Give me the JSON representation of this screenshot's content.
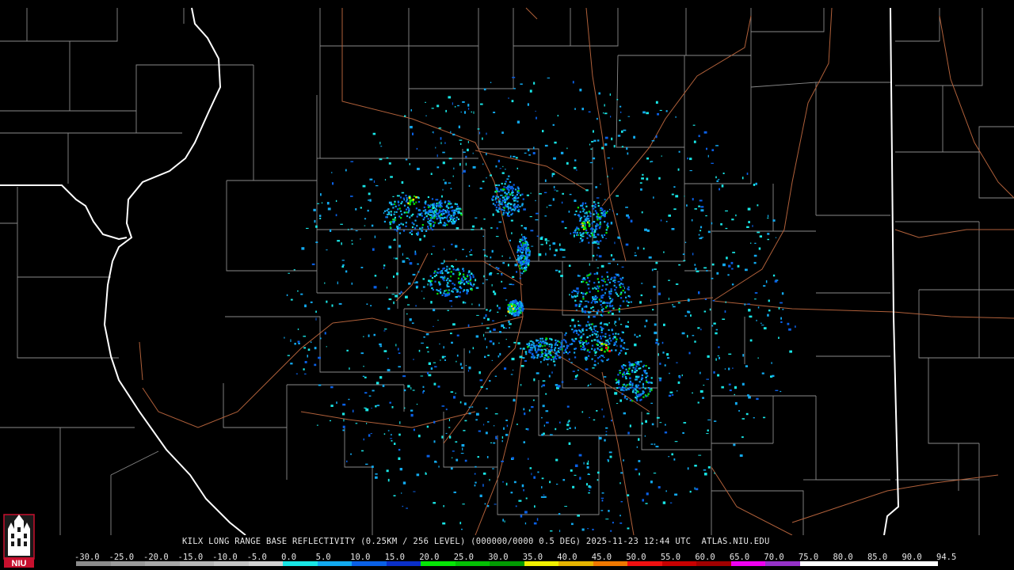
{
  "caption": "KILX LONG RANGE BASE REFLECTIVITY (0.25KM / 256 LEVEL) (000000/0000 0.5 DEG) 2025-11-23 12:44 UTC  ATLAS.NIU.EDU",
  "logo": {
    "text": "NIU",
    "icon": "niu-tower-logo-icon",
    "colors": {
      "red": "#c8102e",
      "white": "#ffffff",
      "dark": "#1a1a1a"
    }
  },
  "map": {
    "background": "#000000",
    "county_line_color": "#8a8a8a",
    "state_line_color": "#ffffff",
    "river_color": "#ffffff",
    "road_color": "#b0603a"
  },
  "colorscale": {
    "labels": [
      "-30.0",
      "-25.0",
      "-20.0",
      "-15.0",
      "-10.0",
      "-5.0",
      "0.0",
      "5.0",
      "10.0",
      "15.0",
      "20.0",
      "25.0",
      "30.0",
      "35.0",
      "40.0",
      "45.0",
      "50.0",
      "55.0",
      "60.0",
      "65.0",
      "70.0",
      "75.0",
      "80.0",
      "85.0",
      "90.0",
      "94.5"
    ],
    "colors": [
      "#8c8c8c",
      "#9a9a9a",
      "#a8a8a8",
      "#b6b6b6",
      "#c4c4c4",
      "#d2d2d2",
      "#19e6e6",
      "#12aaf0",
      "#0a60e6",
      "#0a2fc8",
      "#06e606",
      "#04c004",
      "#029a02",
      "#f0f000",
      "#e6b400",
      "#f07800",
      "#f01010",
      "#c80000",
      "#a00000",
      "#f000f0",
      "#9632c8",
      "#ffffff",
      "#ffffff",
      "#ffffff",
      "#ffffff"
    ],
    "below_bar_color": "#ffffff"
  }
}
